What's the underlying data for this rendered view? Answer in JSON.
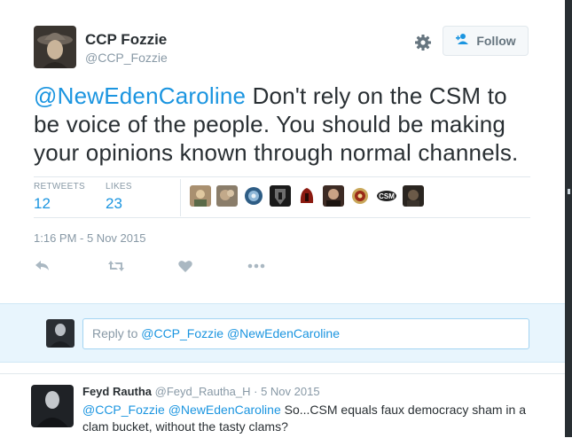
{
  "tweet": {
    "author_name": "CCP Fozzie",
    "author_handle": "@CCP_Fozzie",
    "follow_label": "Follow",
    "text_mention": "@NewEdenCaroline",
    "text_body": " Don't rely on the CSM to be voice of the people. You should be making your opinions known through normal channels.",
    "retweets_label": "RETWEETS",
    "retweets_count": "12",
    "likes_label": "LIKES",
    "likes_count": "23",
    "timestamp": "1:16 PM - 5 Nov 2015"
  },
  "reply_box": {
    "prefix": "Reply to ",
    "mention1": "@CCP_Fozzie",
    "mention2": "@NewEdenCaroline"
  },
  "reply_tweet": {
    "author_name": "Feyd Rautha",
    "author_handle": "@Feyd_Rautha_H",
    "separator": " · ",
    "date": "5 Nov 2015",
    "mention1": "@CCP_Fozzie",
    "mention2": "@NewEdenCaroline",
    "text": " So...CSM equals faux democracy sham in a clam bucket, without the tasty clams?"
  },
  "colors": {
    "link": "#1b95e0",
    "muted": "#8899a6",
    "text": "#292f33",
    "reply_bar_bg": "#e8f5fd"
  },
  "icons": [
    "gear-icon",
    "follow-person-icon",
    "reply-icon",
    "retweet-icon",
    "like-heart-icon",
    "more-icon"
  ]
}
